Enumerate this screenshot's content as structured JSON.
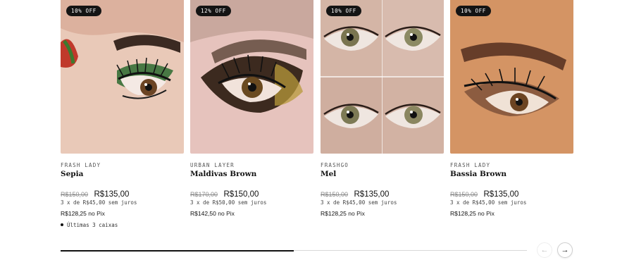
{
  "products": [
    {
      "badge": "10% OFF",
      "brand": "FRASH LADY",
      "name": "Sepia",
      "old_price": "R$150,00",
      "price": "R$135,00",
      "installments": "3 x de R$45,00 sem juros",
      "pix_price": "R$128,25",
      "pix_label": "no Pix",
      "stock_note": "Últimas 3 caixas"
    },
    {
      "badge": "12% OFF",
      "brand": "URBAN LAYER",
      "name": "Maldivas Brown",
      "old_price": "R$170,00",
      "price": "R$150,00",
      "installments": "3 x de R$50,00 sem juros",
      "pix_price": "R$142,50",
      "pix_label": "no Pix"
    },
    {
      "badge": "10% OFF",
      "brand": "FRASHGO",
      "name": "Mel",
      "old_price": "R$150,00",
      "price": "R$135,00",
      "installments": "3 x de R$45,00 sem juros",
      "pix_price": "R$128,25",
      "pix_label": "no Pix"
    },
    {
      "badge": "10% OFF",
      "brand": "FRASH LADY",
      "name": "Bassia Brown",
      "old_price": "R$150,00",
      "price": "R$135,00",
      "installments": "3 x de R$45,00 sem juros",
      "pix_price": "R$128,25",
      "pix_label": "no Pix"
    }
  ],
  "carousel": {
    "progress": 0.5,
    "prev_icon": "arrow-left-icon",
    "next_icon": "arrow-right-icon",
    "prev_glyph": "←",
    "next_glyph": "→"
  },
  "colors": {
    "badge_bg": "#141414",
    "text": "#111111",
    "muted": "#8a8a8a",
    "track": "#d9d9d9"
  }
}
